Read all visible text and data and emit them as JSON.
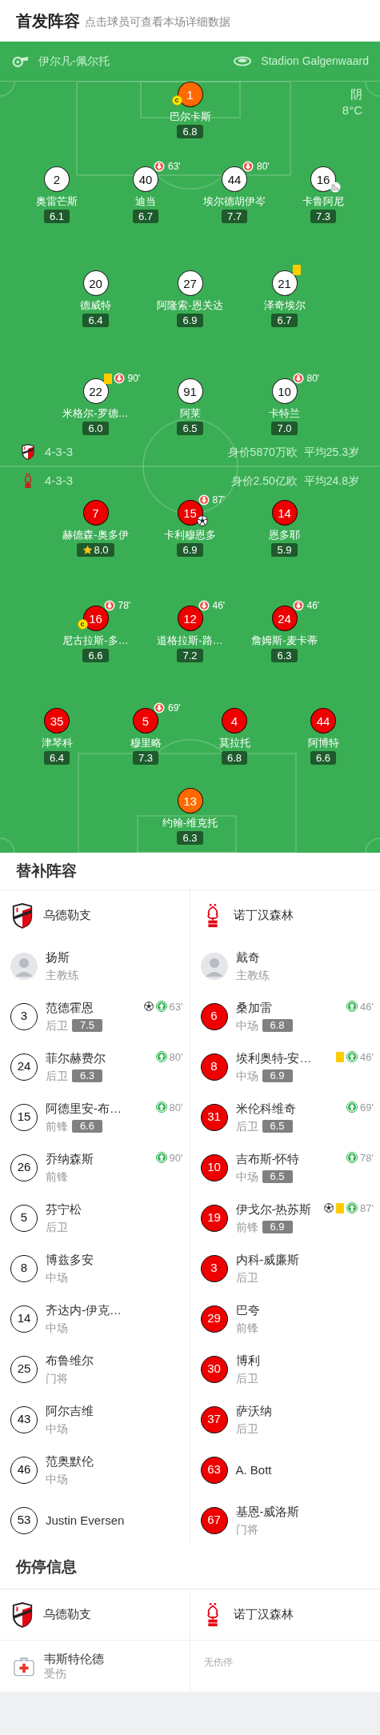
{
  "lineup_header": {
    "title": "首发阵容",
    "subtitle": "点击球员可查看本场详细数据"
  },
  "match_info": {
    "referee": "伊尔凡-佩尔托",
    "stadium": "Stadion Galgenwaard",
    "weather": "阴",
    "temperature": "8°C"
  },
  "home": {
    "formation": "4-3-3",
    "market_value": "身价5870万欧",
    "average_age": "平均25.3岁",
    "lines": [
      [
        {
          "number": "1",
          "name": "巴尔卡斯",
          "rating": "6.8",
          "color": "#ff6a00",
          "events": [
            {
              "kind": "captain",
              "label": "c"
            }
          ]
        }
      ],
      [
        {
          "number": "2",
          "name": "奥雷芒斯",
          "rating": "6.1",
          "color": "#ffffff"
        },
        {
          "number": "40",
          "name": "迪当",
          "rating": "6.7",
          "color": "#ffffff",
          "events": [
            {
              "kind": "sub_off",
              "minute": "63'"
            }
          ]
        },
        {
          "number": "44",
          "name": "埃尔德胡伊岑",
          "rating": "7.7",
          "color": "#ffffff",
          "events": [
            {
              "kind": "sub_off",
              "minute": "80'"
            }
          ]
        },
        {
          "number": "16",
          "name": "卡鲁阿尼",
          "rating": "7.3",
          "color": "#ffffff",
          "events": [
            {
              "kind": "assist"
            }
          ]
        }
      ],
      [
        {
          "number": "20",
          "name": "德威特",
          "rating": "6.4",
          "color": "#ffffff"
        },
        {
          "number": "27",
          "name": "阿隆索-恩关达",
          "rating": "6.9",
          "color": "#ffffff"
        },
        {
          "number": "21",
          "name": "泽奇埃尔",
          "rating": "6.7",
          "color": "#ffffff",
          "events": [
            {
              "kind": "yellow_card"
            }
          ]
        }
      ],
      [
        {
          "number": "22",
          "name": "米格尔-罗德…",
          "rating": "6.0",
          "color": "#ffffff",
          "events": [
            {
              "kind": "yellow_card"
            },
            {
              "kind": "sub_off",
              "minute": "90'"
            }
          ]
        },
        {
          "number": "91",
          "name": "阿莱",
          "rating": "6.5",
          "color": "#ffffff"
        },
        {
          "number": "10",
          "name": "卡特兰",
          "rating": "7.0",
          "color": "#ffffff",
          "events": [
            {
              "kind": "sub_off",
              "minute": "80'"
            }
          ]
        }
      ]
    ]
  },
  "away": {
    "formation": "4-3-3",
    "market_value": "身价2.50亿欧",
    "average_age": "平均24.8岁",
    "lines": [
      [
        {
          "number": "7",
          "name": "赫德森-奥多伊",
          "rating": "8.0",
          "color": "#ee0000",
          "events": [
            {
              "kind": "best_player"
            }
          ]
        },
        {
          "number": "15",
          "name": "卡利穆恩多",
          "rating": "6.9",
          "color": "#ee0000",
          "events": [
            {
              "kind": "sub_off",
              "minute": "87'"
            },
            {
              "kind": "goal"
            }
          ]
        },
        {
          "number": "14",
          "name": "恩多耶",
          "rating": "5.9",
          "color": "#ee0000"
        }
      ],
      [
        {
          "number": "16",
          "name": "尼古拉斯-多…",
          "rating": "6.6",
          "color": "#ee0000",
          "events": [
            {
              "kind": "captain",
              "label": "c"
            },
            {
              "kind": "sub_off",
              "minute": "78'"
            }
          ]
        },
        {
          "number": "12",
          "name": "道格拉斯-路…",
          "rating": "7.2",
          "color": "#ee0000",
          "events": [
            {
              "kind": "sub_off",
              "minute": "46'"
            }
          ]
        },
        {
          "number": "24",
          "name": "詹姆斯-麦卡蒂",
          "rating": "6.3",
          "color": "#ee0000",
          "events": [
            {
              "kind": "sub_off",
              "minute": "46'"
            }
          ]
        }
      ],
      [
        {
          "number": "35",
          "name": "津琴科",
          "rating": "6.4",
          "color": "#ee0000"
        },
        {
          "number": "5",
          "name": "穆里略",
          "rating": "7.3",
          "color": "#ee0000",
          "events": [
            {
              "kind": "sub_off",
              "minute": "69'"
            }
          ]
        },
        {
          "number": "4",
          "name": "莫拉托",
          "rating": "6.8",
          "color": "#ee0000"
        },
        {
          "number": "44",
          "name": "阿博特",
          "rating": "6.6",
          "color": "#ee0000"
        }
      ],
      [
        {
          "number": "13",
          "name": "约翰-维克托",
          "rating": "6.3",
          "color": "#ff6a00"
        }
      ]
    ]
  },
  "substitutes": {
    "title": "替补阵容",
    "teams": [
      {
        "kind": "utrecht",
        "name": "乌德勒支",
        "coach": {
          "name": "扬斯",
          "role": "主教练"
        },
        "players": [
          {
            "number": "3",
            "name": "范德霍恩",
            "position": "后卫",
            "rating": "7.5",
            "events": [
              {
                "kind": "goal"
              },
              {
                "kind": "sub_on",
                "minute": "63'"
              }
            ]
          },
          {
            "number": "24",
            "name": "菲尔赫费尔",
            "position": "后卫",
            "rating": "6.3",
            "events": [
              {
                "kind": "sub_on",
                "minute": "80'"
              }
            ]
          },
          {
            "number": "15",
            "name": "阿德里安-布…",
            "position": "前锋",
            "rating": "6.6",
            "events": [
              {
                "kind": "sub_on",
                "minute": "80'"
              }
            ]
          },
          {
            "number": "26",
            "name": "乔纳森斯",
            "position": "前锋",
            "events": [
              {
                "kind": "sub_on",
                "minute": "90'"
              }
            ]
          },
          {
            "number": "5",
            "name": "芬宁松",
            "position": "后卫"
          },
          {
            "number": "8",
            "name": "博兹多安",
            "position": "中场"
          },
          {
            "number": "14",
            "name": "齐达内-伊克…",
            "position": "中场"
          },
          {
            "number": "25",
            "name": "布鲁维尔",
            "position": "门将"
          },
          {
            "number": "43",
            "name": "阿尔吉维",
            "position": "中场"
          },
          {
            "number": "46",
            "name": "范奥默伦",
            "position": "中场"
          },
          {
            "number": "53",
            "name": "Justin Eversen"
          }
        ]
      },
      {
        "kind": "forest",
        "name": "诺丁汉森林",
        "coach": {
          "name": "戴奇",
          "role": "主教练"
        },
        "players": [
          {
            "number": "6",
            "name": "桑加雷",
            "position": "中场",
            "rating": "6.8",
            "events": [
              {
                "kind": "sub_on",
                "minute": "46'"
              }
            ]
          },
          {
            "number": "8",
            "name": "埃利奥特-安…",
            "position": "中场",
            "rating": "6.9",
            "events": [
              {
                "kind": "yellow_card"
              },
              {
                "kind": "sub_on",
                "minute": "46'"
              }
            ]
          },
          {
            "number": "31",
            "name": "米伦科维奇",
            "position": "后卫",
            "rating": "6.5",
            "events": [
              {
                "kind": "sub_on",
                "minute": "69'"
              }
            ]
          },
          {
            "number": "10",
            "name": "吉布斯-怀特",
            "position": "中场",
            "rating": "6.5",
            "events": [
              {
                "kind": "sub_on",
                "minute": "78'"
              }
            ]
          },
          {
            "number": "19",
            "name": "伊戈尔-热苏斯",
            "position": "前锋",
            "rating": "6.9",
            "events": [
              {
                "kind": "goal"
              },
              {
                "kind": "yellow_card"
              },
              {
                "kind": "sub_on",
                "minute": "87'"
              }
            ]
          },
          {
            "number": "3",
            "name": "内科-威廉斯",
            "position": "后卫"
          },
          {
            "number": "29",
            "name": "巴夸",
            "position": "前锋"
          },
          {
            "number": "30",
            "name": "博利",
            "position": "后卫"
          },
          {
            "number": "37",
            "name": "萨沃纳",
            "position": "后卫"
          },
          {
            "number": "63",
            "name": "A. Bott"
          },
          {
            "number": "67",
            "name": "基恩-威洛斯",
            "position": "门将"
          }
        ]
      }
    ]
  },
  "injuries": {
    "title": "伤停信息",
    "teams": [
      {
        "kind": "utrecht",
        "name": "乌德勒支",
        "players": [
          {
            "name": "韦斯特伦德",
            "status": "受伤"
          }
        ]
      },
      {
        "kind": "forest",
        "name": "诺丁汉森林",
        "empty_text": "无伤停"
      }
    ]
  }
}
